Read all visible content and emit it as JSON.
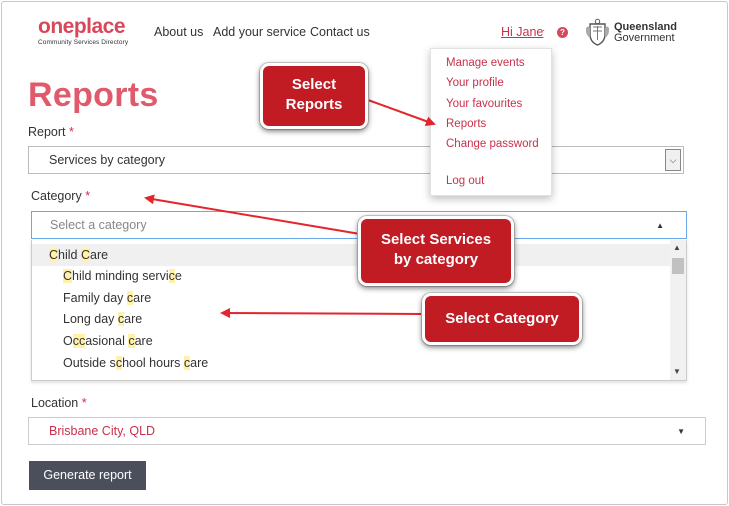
{
  "header": {
    "logo_text": "oneplace",
    "logo_subtext": "Community Services Directory",
    "nav": [
      "About us",
      "Add your service",
      "Contact us"
    ],
    "user_link": "Hi Jane",
    "user_caret": "·",
    "help_glyph": "?",
    "gov_logo_line1": "Queensland",
    "gov_logo_line2": "Government"
  },
  "user_menu": {
    "items": [
      "Manage events",
      "Your profile",
      "Your favourites",
      "Reports",
      "Change password",
      "Log out"
    ]
  },
  "page": {
    "title": "Reports"
  },
  "report_field": {
    "label": "Report",
    "required_mark": "*",
    "value": "Services by category"
  },
  "category_field": {
    "label": "Category",
    "required_mark": "*",
    "placeholder": "Select a category",
    "options": [
      {
        "text": "Child Care",
        "type": "group"
      },
      {
        "text": "Child minding service",
        "type": "item"
      },
      {
        "text": "Family day care",
        "type": "item"
      },
      {
        "text": "Long day care",
        "type": "item"
      },
      {
        "text": "Occasional care",
        "type": "item"
      },
      {
        "text": "Outside school hours care",
        "type": "item"
      }
    ]
  },
  "location_field": {
    "label": "Location",
    "required_mark": "*",
    "value": "Brisbane City, QLD"
  },
  "generate_button": "Generate report",
  "callouts": {
    "reports": [
      "Select",
      "Reports"
    ],
    "services": [
      "Select Services",
      "by category"
    ],
    "category": "Select Category"
  },
  "colors": {
    "brand": "#d9475b",
    "link": "#c8314a",
    "callout": "#c11b23",
    "button": "#4b4f5c",
    "highlight": "#fff1a8"
  }
}
